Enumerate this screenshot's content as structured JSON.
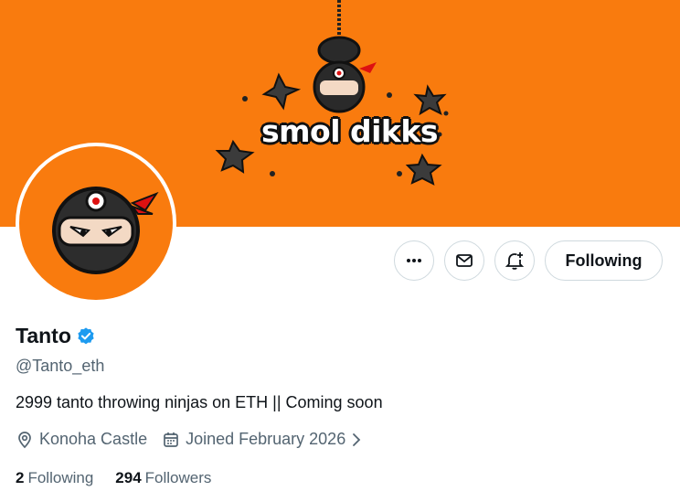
{
  "banner": {
    "text": "smol dikks"
  },
  "profile": {
    "name": "Tanto",
    "handle": "@Tanto_eth",
    "bio": "2999 tanto throwing ninjas on ETH || Coming soon",
    "location": "Konoha Castle",
    "joined": "Joined February 2026",
    "following_count": "2",
    "following_label": "Following",
    "followers_count": "294",
    "followers_label": "Followers"
  },
  "actions": {
    "more_icon": "more-horizontal-icon",
    "message_icon": "mail-icon",
    "notify_icon": "bell-plus-icon",
    "follow_label": "Following"
  },
  "colors": {
    "banner": "#f97b0e",
    "verified": "#1d9bf0",
    "secondary_text": "#536471",
    "primary_text": "#0f1419",
    "border": "#cfd9de"
  }
}
